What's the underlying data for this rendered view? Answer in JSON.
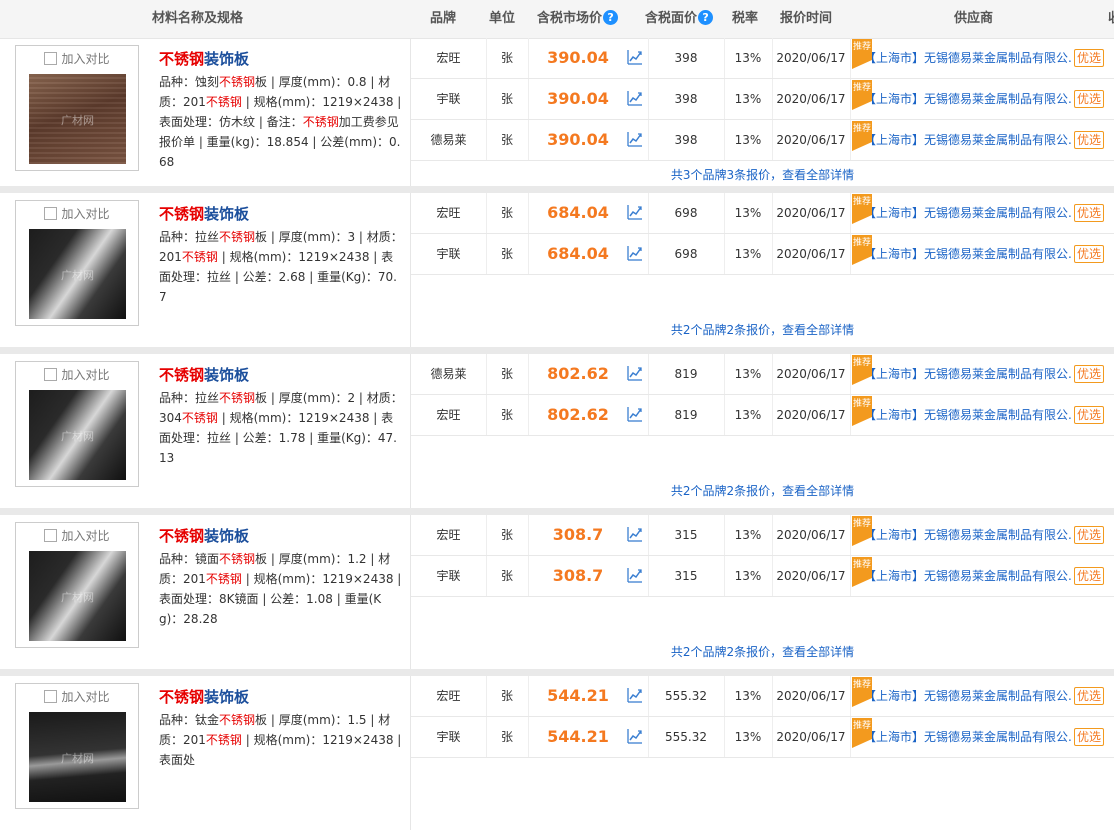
{
  "header": {
    "name_spec": "材料名称及规格",
    "brand": "品牌",
    "unit": "单位",
    "market_price": "含税市场价",
    "face_price": "含税面价",
    "tax_rate": "税率",
    "quote_time": "报价时间",
    "supplier": "供应商",
    "help_icon": "?",
    "right_cut": "收"
  },
  "common": {
    "compare_label": "加入对比",
    "watermark": "广材网",
    "recommend_ribbon": "推荐",
    "preferred_badge": "优选",
    "trend_icon": "trend-chart-icon"
  },
  "products": [
    {
      "title_kw": "不锈钢",
      "title_rest": "装饰板",
      "photo": "wood",
      "desc": [
        {
          "t": "品种：蚀刻"
        },
        {
          "t": "不锈钢",
          "k": true
        },
        {
          "t": "板 | 厚度(mm)：0.8 | 材质：201"
        },
        {
          "t": "不锈钢",
          "k": true
        },
        {
          "t": " | 规格(mm)：1219×2438 | 表面处理：仿木纹 | 备注："
        },
        {
          "t": "不锈钢",
          "k": true
        },
        {
          "t": "加工费参见报价单 | 重量(kg)：18.854 | 公差(mm)：0.68"
        }
      ],
      "quotes": [
        {
          "brand": "宏旺",
          "unit": "张",
          "price": "390.04",
          "face": "398",
          "tax": "13%",
          "date": "2020/06/17",
          "supplier": "【上海市】无锡德易莱金属制品有限公..."
        },
        {
          "brand": "宇联",
          "unit": "张",
          "price": "390.04",
          "face": "398",
          "tax": "13%",
          "date": "2020/06/17",
          "supplier": "【上海市】无锡德易莱金属制品有限公..."
        },
        {
          "brand": "德易莱",
          "unit": "张",
          "price": "390.04",
          "face": "398",
          "tax": "13%",
          "date": "2020/06/17",
          "supplier": "【上海市】无锡德易莱金属制品有限公..."
        }
      ],
      "summary": "共3个品牌3条报价，查看全部详情"
    },
    {
      "title_kw": "不锈钢",
      "title_rest": "装饰板",
      "photo": "steel",
      "desc": [
        {
          "t": "品种：拉丝"
        },
        {
          "t": "不锈钢",
          "k": true
        },
        {
          "t": "板 | 厚度(mm)：3 | 材质：201"
        },
        {
          "t": "不锈钢",
          "k": true
        },
        {
          "t": " | 规格(mm)：1219×2438 | 表面处理：拉丝 | 公差：2.68 | 重量(Kg)：70.7"
        }
      ],
      "quotes": [
        {
          "brand": "宏旺",
          "unit": "张",
          "price": "684.04",
          "face": "698",
          "tax": "13%",
          "date": "2020/06/17",
          "supplier": "【上海市】无锡德易莱金属制品有限公..."
        },
        {
          "brand": "宇联",
          "unit": "张",
          "price": "684.04",
          "face": "698",
          "tax": "13%",
          "date": "2020/06/17",
          "supplier": "【上海市】无锡德易莱金属制品有限公..."
        }
      ],
      "summary": "共2个品牌2条报价，查看全部详情"
    },
    {
      "title_kw": "不锈钢",
      "title_rest": "装饰板",
      "photo": "steel",
      "desc": [
        {
          "t": "品种：拉丝"
        },
        {
          "t": "不锈钢",
          "k": true
        },
        {
          "t": "板 | 厚度(mm)：2 | 材质：304"
        },
        {
          "t": "不锈钢",
          "k": true
        },
        {
          "t": " | 规格(mm)：1219×2438 | 表面处理：拉丝 | 公差：1.78 | 重量(Kg)：47.13"
        }
      ],
      "quotes": [
        {
          "brand": "德易莱",
          "unit": "张",
          "price": "802.62",
          "face": "819",
          "tax": "13%",
          "date": "2020/06/17",
          "supplier": "【上海市】无锡德易莱金属制品有限公..."
        },
        {
          "brand": "宏旺",
          "unit": "张",
          "price": "802.62",
          "face": "819",
          "tax": "13%",
          "date": "2020/06/17",
          "supplier": "【上海市】无锡德易莱金属制品有限公..."
        }
      ],
      "summary": "共2个品牌2条报价，查看全部详情"
    },
    {
      "title_kw": "不锈钢",
      "title_rest": "装饰板",
      "photo": "steel",
      "desc": [
        {
          "t": "品种：镜面"
        },
        {
          "t": "不锈钢",
          "k": true
        },
        {
          "t": "板 | 厚度(mm)：1.2 | 材质：201"
        },
        {
          "t": "不锈钢",
          "k": true
        },
        {
          "t": " | 规格(mm)：1219×2438 | 表面处理：8K镜面 | 公差：1.08 | 重量(Kg)：28.28"
        }
      ],
      "quotes": [
        {
          "brand": "宏旺",
          "unit": "张",
          "price": "308.7",
          "face": "315",
          "tax": "13%",
          "date": "2020/06/17",
          "supplier": "【上海市】无锡德易莱金属制品有限公..."
        },
        {
          "brand": "宇联",
          "unit": "张",
          "price": "308.7",
          "face": "315",
          "tax": "13%",
          "date": "2020/06/17",
          "supplier": "【上海市】无锡德易莱金属制品有限公..."
        }
      ],
      "summary": "共2个品牌2条报价，查看全部详情"
    },
    {
      "title_kw": "不锈钢",
      "title_rest": "装饰板",
      "photo": "steel2",
      "desc": [
        {
          "t": "品种：钛金"
        },
        {
          "t": "不锈钢",
          "k": true
        },
        {
          "t": "板 | 厚度(mm)：1.5 | 材质：201"
        },
        {
          "t": "不锈钢",
          "k": true
        },
        {
          "t": " | 规格(mm)：1219×2438 | 表面处"
        }
      ],
      "quotes": [
        {
          "brand": "宏旺",
          "unit": "张",
          "price": "544.21",
          "face": "555.32",
          "tax": "13%",
          "date": "2020/06/17",
          "supplier": "【上海市】无锡德易莱金属制品有限公..."
        },
        {
          "brand": "宇联",
          "unit": "张",
          "price": "544.21",
          "face": "555.32",
          "tax": "13%",
          "date": "2020/06/17",
          "supplier": "【上海市】无锡德易莱金属制品有限公..."
        }
      ],
      "summary": ""
    }
  ]
}
